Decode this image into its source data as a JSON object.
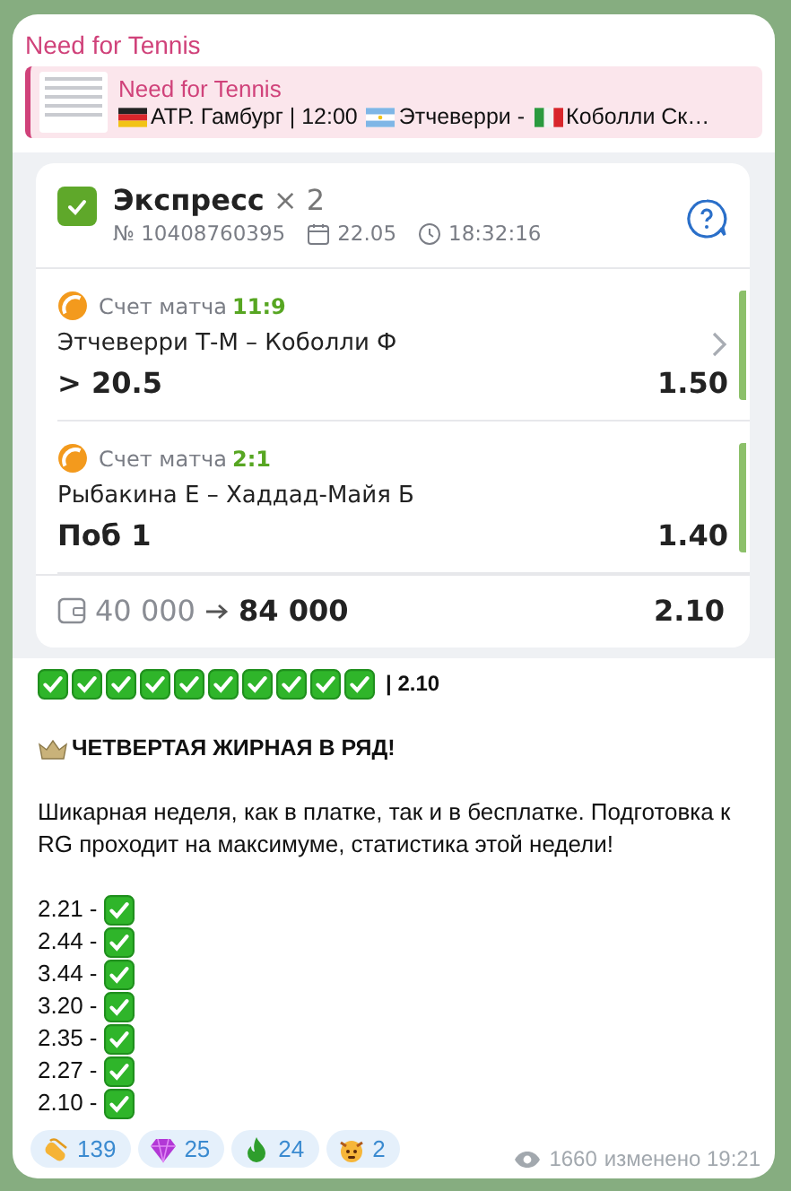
{
  "channel_name": "Need for Tennis",
  "reply": {
    "title": "Need for Tennis",
    "parts": [
      "АТР. Гамбург | 12:00",
      "Этчеверри -",
      "Коболли  Ск…"
    ]
  },
  "bet_slip": {
    "title": "Экспресс",
    "multiplier": "× 2",
    "number": "№ 10408760395",
    "date": "22.05",
    "time": "18:32:16",
    "legs": [
      {
        "market": "Счет матча",
        "score": "11:9",
        "players": "Этчеверри Т-М – Коболли Ф",
        "pick": "> 20.5",
        "odds": "1.50",
        "expandable": true
      },
      {
        "market": "Счет матча",
        "score": "2:1",
        "players": "Рыбакина Е – Хаддад-Майя Б",
        "pick": "Поб 1",
        "odds": "1.40",
        "expandable": false
      }
    ],
    "stake": "40 000",
    "payout": "84 000",
    "total_odds": "2.10"
  },
  "post": {
    "result_line": "| 2.10",
    "headline": "ЧЕТВЕРТАЯ ЖИРНАЯ В РЯД!",
    "paragraph": "Шикарная неделя, как в платке, так и в бесплатке. Подготовка к RG проходит на максимуме, статистика этой недели!",
    "stats": [
      "2.21 -",
      "2.44 -",
      "3.44 -",
      "3.20 -",
      "2.35 -",
      "2.27 -",
      "2.10 -"
    ]
  },
  "reactions": [
    {
      "count": "139"
    },
    {
      "count": "25"
    },
    {
      "count": "24"
    },
    {
      "count": "2"
    }
  ],
  "footer": {
    "views": "1660",
    "edited": "изменено 19:21"
  }
}
